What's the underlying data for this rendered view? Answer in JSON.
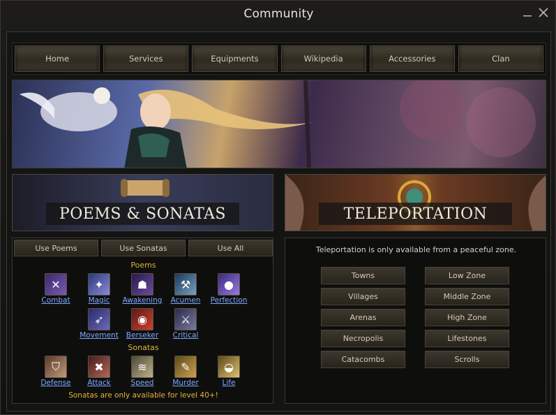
{
  "window": {
    "title": "Community"
  },
  "nav": {
    "items": [
      "Home",
      "Services",
      "Equipments",
      "Wikipedia",
      "Accessories",
      "Clan"
    ]
  },
  "sections": {
    "poems_title": "POEMS & SONATAS",
    "teleport_title": "TELEPORTATION"
  },
  "poems_panel": {
    "buttons": [
      "Use Poems",
      "Use Sonatas",
      "Use All"
    ],
    "poems_heading": "Poems",
    "poems": [
      "Combat",
      "Magic",
      "Awakening",
      "Acumen",
      "Perfection",
      "Movement",
      "Berseker",
      "Critical"
    ],
    "sonatas_heading": "Sonatas",
    "sonatas": [
      "Defense",
      "Attack",
      "Speed",
      "Murder",
      "Life"
    ],
    "note": "Sonatas are only available for level 40+!"
  },
  "teleport_panel": {
    "note": "Teleportation is only available from a peaceful zone.",
    "left": [
      "Towns",
      "Villages",
      "Arenas",
      "Necropolis",
      "Catacombs"
    ],
    "right": [
      "Low Zone",
      "Middle Zone",
      "High Zone",
      "Lifestones",
      "Scrolls"
    ]
  },
  "colors": {
    "accent_gold": "#e3b53b",
    "link_blue": "#7fa8ff"
  }
}
